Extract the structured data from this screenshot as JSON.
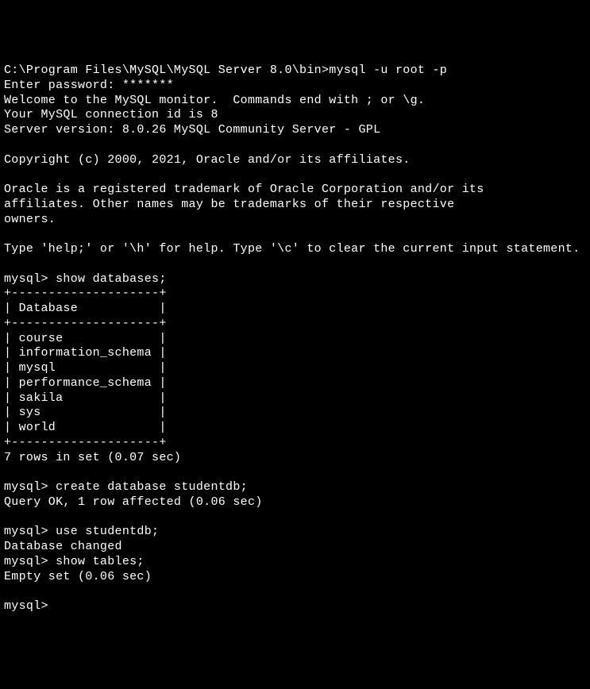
{
  "login": {
    "command_line": "C:\\Program Files\\MySQL\\MySQL Server 8.0\\bin>mysql -u root -p",
    "password_prompt": "Enter password: *******",
    "welcome": "Welcome to the MySQL monitor.  Commands end with ; or \\g.",
    "connection_id": "Your MySQL connection id is 8",
    "server_version": "Server version: 8.0.26 MySQL Community Server - GPL"
  },
  "copyright": {
    "line": "Copyright (c) 2000, 2021, Oracle and/or its affiliates."
  },
  "trademark": {
    "line1": "Oracle is a registered trademark of Oracle Corporation and/or its",
    "line2": "affiliates. Other names may be trademarks of their respective",
    "line3": "owners."
  },
  "help": {
    "line": "Type 'help;' or '\\h' for help. Type '\\c' to clear the current input statement."
  },
  "session": {
    "prompt": "mysql>",
    "cmd1": "mysql> show databases;",
    "table_border": "+--------------------+",
    "table_header": "| Database           |",
    "table_rows": [
      "| course             |",
      "| information_schema |",
      "| mysql              |",
      "| performance_schema |",
      "| sakila             |",
      "| sys                |",
      "| world              |"
    ],
    "result1": "7 rows in set (0.07 sec)",
    "cmd2": "mysql> create database studentdb;",
    "result2": "Query OK, 1 row affected (0.06 sec)",
    "cmd3": "mysql> use studentdb;",
    "result3": "Database changed",
    "cmd4": "mysql> show tables;",
    "result4": "Empty set (0.06 sec)",
    "final_prompt": "mysql>"
  }
}
